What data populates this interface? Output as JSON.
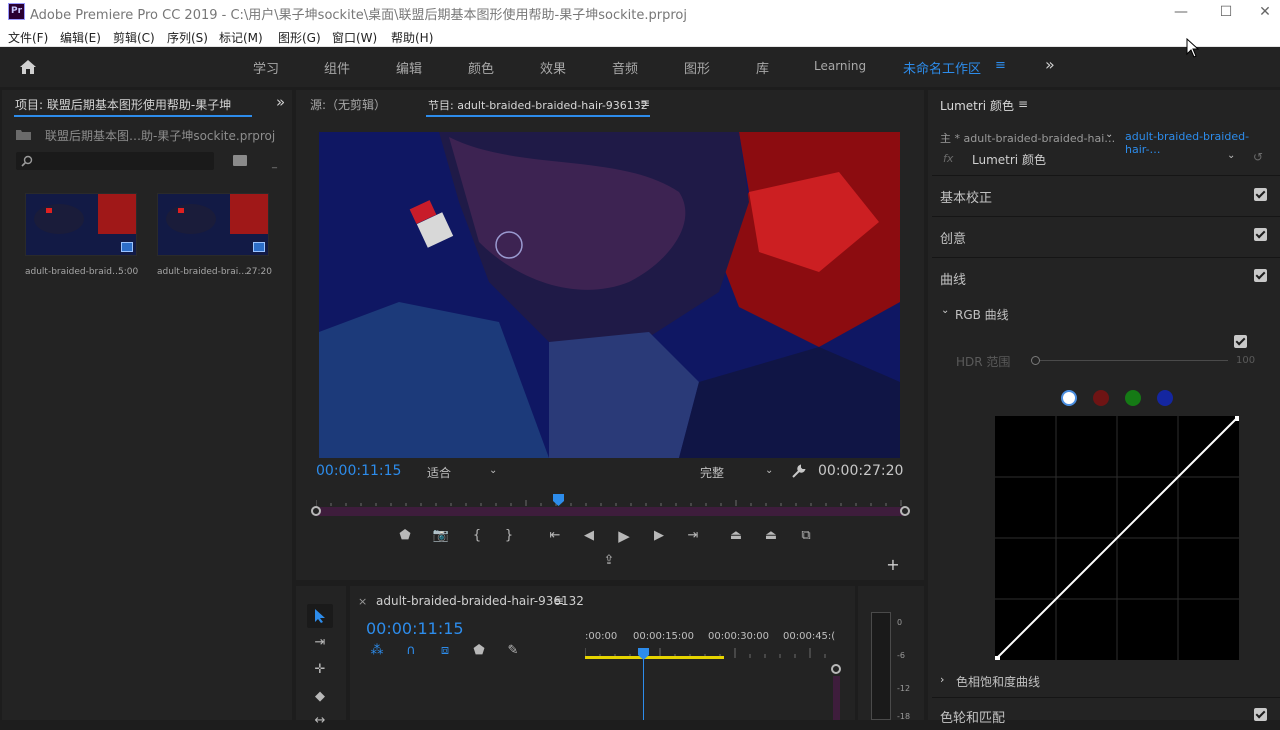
{
  "titlebar": {
    "logo": "Pr",
    "title": "Adobe Premiere Pro CC 2019 - C:\\用户\\果子坤sockite\\桌面\\联盟后期基本图形使用帮助-果子坤sockite.prproj",
    "minimize": "—",
    "maximize": "☐",
    "close": "✕"
  },
  "menu": [
    "文件(F)",
    "编辑(E)",
    "剪辑(C)",
    "序列(S)",
    "标记(M)",
    "图形(G)",
    "窗口(W)",
    "帮助(H)"
  ],
  "workspaces": {
    "items": [
      "学习",
      "组件",
      "编辑",
      "颜色",
      "效果",
      "音频",
      "图形",
      "库",
      "Learning"
    ],
    "active": "未命名工作区",
    "active_menu": "≡",
    "more": "»"
  },
  "project": {
    "tab": "项目: 联盟后期基本图形使用帮助-果子坤",
    "expand": "»",
    "file": "联盟后期基本图…助-果子坤sockite.prproj",
    "search_placeholder": "",
    "clips": [
      {
        "name": "adult-braided-braid…",
        "duration": "5:00"
      },
      {
        "name": "adult-braided-brai…",
        "duration": "27:20"
      }
    ]
  },
  "monitor": {
    "source_tab": "源:（无剪辑）",
    "program_tab": "节目: adult-braided-braided-hair-936132",
    "tab_menu": "≡",
    "current_time": "00:00:11:15",
    "zoom": "适合",
    "quality": "完整",
    "duration": "00:00:27:20",
    "playhead_fraction": 0.41
  },
  "timeline": {
    "close": "×",
    "tab": "adult-braided-braided-hair-936132",
    "menu": "≡",
    "timecode": "00:00:11:15",
    "ruler": [
      ":00:00",
      "00:00:15:00",
      "00:00:30:00",
      "00:00:45:("
    ],
    "meter_labels": [
      "0",
      "-6",
      "-12",
      "-18"
    ]
  },
  "lumetri": {
    "title": "Lumetri 颜色",
    "title_menu": "≡",
    "master": "主 * adult-braided-braided-hai…",
    "clip": "adult-braided-braided-hair-…",
    "fx_label": "fx",
    "effect": "Lumetri 颜色",
    "sections": [
      "基本校正",
      "创意",
      "曲线"
    ],
    "rgb_curves": "RGB 曲线",
    "hdr_label": "HDR 范围",
    "hdr_value": "100",
    "hue_sat": "色相饱和度曲线",
    "color_wheels": "色轮和匹配"
  },
  "colors": {
    "accent": "#2d8ceb",
    "curve_white": "#ffffff",
    "curve_red": "#8b1a1a",
    "curve_green": "#1a8b1a",
    "curve_blue": "#1a2a9b"
  }
}
